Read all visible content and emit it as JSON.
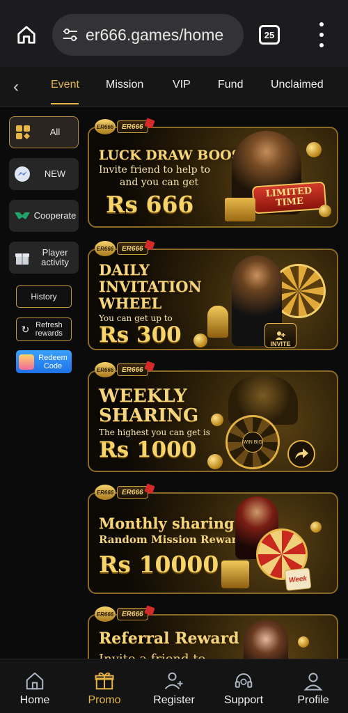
{
  "browser": {
    "url": "er666.games/home",
    "tab_count": "25",
    "icons": [
      "home-icon",
      "tune-icon",
      "tabs-icon",
      "more-vert-icon"
    ]
  },
  "tabs": [
    {
      "label": "Event",
      "active": true
    },
    {
      "label": "Mission",
      "active": false
    },
    {
      "label": "VIP",
      "active": false
    },
    {
      "label": "Fund",
      "active": false
    },
    {
      "label": "Unclaimed",
      "active": false
    }
  ],
  "sidebar": {
    "categories": [
      {
        "label": "All",
        "icon": "grid-icon",
        "active": true
      },
      {
        "label": "NEW",
        "icon": "messenger-icon",
        "active": false
      },
      {
        "label": "Cooperate",
        "icon": "handshake-icon",
        "active": false
      },
      {
        "label": "Player activity",
        "icon": "gift-icon",
        "active": false
      }
    ],
    "history_label": "History",
    "refresh_label": "Refresh rewards",
    "redeem_label": "Redeem Code"
  },
  "banners": [
    {
      "brand": "ER666",
      "title": "LUCK DRAW BOOST",
      "subtitle_1": "Invite friend to help to",
      "subtitle_2": "and you can get",
      "amount": "Rs 666",
      "badge": "LIMITED TIME"
    },
    {
      "brand": "ER666",
      "title_1": "DAILY",
      "title_2": "INVITATION",
      "title_3": "WHEEL",
      "subtitle": "You can get up to",
      "amount": "Rs 300",
      "badge": "INVITE"
    },
    {
      "brand": "ER666",
      "title_1": "WEEKLY",
      "title_2": "SHARING",
      "subtitle": "The highest you can get is",
      "amount": "Rs 1000",
      "wheel": "WIN BIG"
    },
    {
      "brand": "ER666",
      "title": "Monthly sharing",
      "subtitle": "Random Mission Reward",
      "amount": "Rs 10000",
      "badge": "Week"
    },
    {
      "brand": "ER666",
      "title": "Referral Reward",
      "subtitle": "Invite a friend to"
    }
  ],
  "bottom_nav": [
    {
      "label": "Home",
      "icon": "home-icon"
    },
    {
      "label": "Promo",
      "icon": "gift-icon"
    },
    {
      "label": "Register",
      "icon": "add-user-icon"
    },
    {
      "label": "Support",
      "icon": "headset-icon"
    },
    {
      "label": "Profile",
      "icon": "profile-icon"
    }
  ],
  "colors": {
    "accent": "#e5b548",
    "background": "#0b0b0b",
    "redeem": "#2a86f0"
  }
}
